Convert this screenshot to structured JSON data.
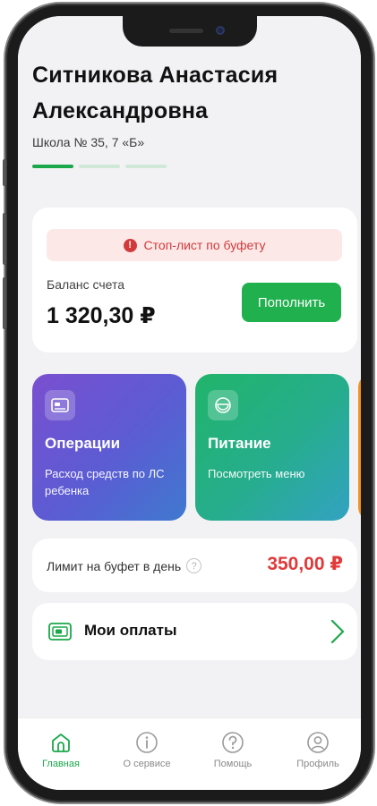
{
  "user": {
    "full_name": "Ситникова Анастасия Александровна",
    "school": "Школа № 35, 7 «Б»"
  },
  "pager": {
    "count": 3,
    "active_index": 0
  },
  "balance_card": {
    "stop_banner": "Стоп-лист по буфету",
    "balance_label": "Баланс счета",
    "balance_value": "1 320,30 ₽",
    "topup_label": "Пополнить"
  },
  "tiles": [
    {
      "title": "Операции",
      "subtitle": "Расход средств по ЛС ребенка",
      "icon": "card-icon"
    },
    {
      "title": "Питание",
      "subtitle": "Посмотреть меню",
      "icon": "bowl-icon"
    }
  ],
  "limit": {
    "label": "Лимит на буфет в день",
    "value": "350,00 ₽"
  },
  "payments": {
    "label": "Мои оплаты",
    "icon": "card-icon"
  },
  "tabbar": {
    "items": [
      {
        "label": "Главная",
        "icon": "home-icon",
        "active": true
      },
      {
        "label": "О сервисе",
        "icon": "info-icon",
        "active": false
      },
      {
        "label": "Помощь",
        "icon": "help-icon",
        "active": false
      },
      {
        "label": "Профиль",
        "icon": "profile-icon",
        "active": false
      }
    ]
  },
  "colors": {
    "accent_green": "#1aa84a",
    "alert_red": "#d23a3a",
    "limit_red": "#e03a3a",
    "extra_tile_orange": "#f29221"
  }
}
